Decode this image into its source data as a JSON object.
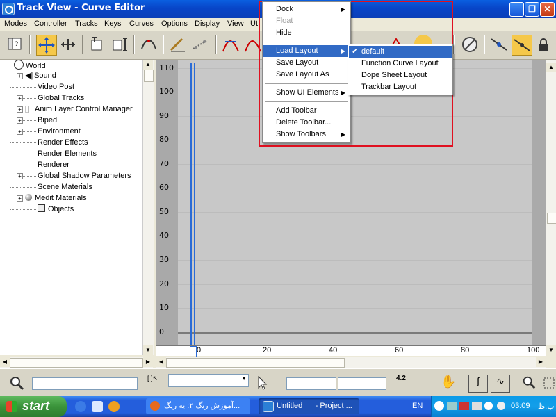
{
  "window": {
    "title": "Track View - Curve Editor"
  },
  "menubar": {
    "items": [
      "Modes",
      "Controller",
      "Tracks",
      "Keys",
      "Curves",
      "Options",
      "Display",
      "View",
      "Ut"
    ]
  },
  "tree": {
    "items": [
      {
        "label": "World"
      },
      {
        "label": "Sound"
      },
      {
        "label": "Video Post"
      },
      {
        "label": "Global Tracks"
      },
      {
        "label": "Anim Layer Control Manager"
      },
      {
        "label": "Biped"
      },
      {
        "label": "Environment"
      },
      {
        "label": "Render Effects"
      },
      {
        "label": "Render Elements"
      },
      {
        "label": "Renderer"
      },
      {
        "label": "Global Shadow Parameters"
      },
      {
        "label": "Scene Materials"
      },
      {
        "label": "Medit Materials"
      },
      {
        "label": "Objects"
      }
    ]
  },
  "graph": {
    "y_labels": [
      "110",
      "100",
      "90",
      "80",
      "70",
      "60",
      "50",
      "40",
      "30",
      "20",
      "10",
      "0"
    ],
    "x_labels": [
      "0",
      "20",
      "40",
      "60",
      "80",
      "100"
    ]
  },
  "context_menu": {
    "items": [
      {
        "label": "Dock",
        "submenu": true
      },
      {
        "label": "Float",
        "disabled": true
      },
      {
        "label": "Hide"
      },
      {
        "label": "Load Layout",
        "submenu": true,
        "selected": true
      },
      {
        "label": "Save Layout"
      },
      {
        "label": "Save Layout As"
      },
      {
        "label": "Show UI Elements",
        "submenu": true
      },
      {
        "label": "Add Toolbar"
      },
      {
        "label": "Delete Toolbar..."
      },
      {
        "label": "Show Toolbars",
        "submenu": true
      }
    ]
  },
  "submenu": {
    "items": [
      {
        "label": "default",
        "checked": true
      },
      {
        "label": "Function Curve Layout"
      },
      {
        "label": "Dope Sheet Layout"
      },
      {
        "label": "Trackbar Layout"
      }
    ]
  },
  "status": {
    "value_readout": "4.2"
  },
  "taskbar": {
    "start_label": "start",
    "tasks": [
      {
        "label": "آموزش ریگ ۲: یه ریگ..."
      },
      {
        "label": "Untitled      - Project ..."
      }
    ],
    "language": "EN",
    "clock": "03:09",
    "ampm": "ب.ظ"
  },
  "colors": {
    "selection": "#316ac5",
    "highlight_outline": "#e01020",
    "curve_line": "#2a6bd6"
  }
}
